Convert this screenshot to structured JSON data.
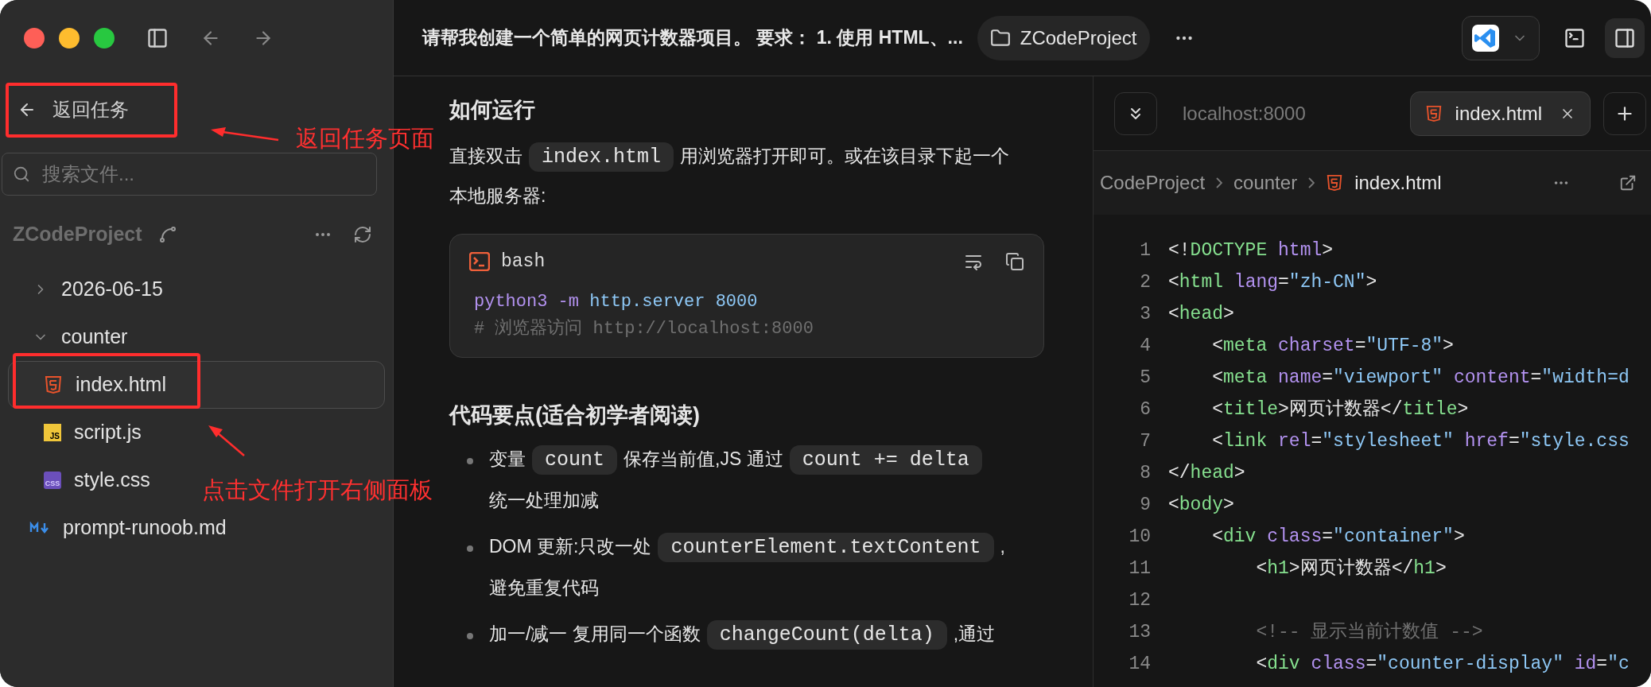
{
  "sidebar": {
    "back_label": "返回任务",
    "search": {
      "placeholder": "搜索文件..."
    },
    "project": "ZCodeProject",
    "tree": [
      {
        "name": "2026-06-15",
        "kind": "folder",
        "expanded": false,
        "selected": false
      },
      {
        "name": "counter",
        "kind": "folder",
        "expanded": true,
        "selected": false,
        "children": [
          {
            "name": "index.html",
            "kind": "html",
            "selected": true
          },
          {
            "name": "script.js",
            "kind": "js",
            "badge": "JS",
            "selected": false
          },
          {
            "name": "style.css",
            "kind": "css",
            "badge": "CSS",
            "selected": false
          }
        ]
      },
      {
        "name": "prompt-runoob.md",
        "kind": "md",
        "selected": false
      }
    ]
  },
  "header": {
    "title": "请帮我创建一个简单的网页计数器项目。 要求： 1. 使用 HTML、...",
    "folder": "ZCodeProject"
  },
  "chat": {
    "heading1": "如何运行",
    "paragraph": [
      {
        "kind": "text",
        "text": "直接双击"
      },
      {
        "kind": "code",
        "text": "index.html"
      },
      {
        "kind": "text",
        "text": "用浏览器打开即可。或在该目录下起一个本地服务器:"
      }
    ],
    "code_block": {
      "language": "bash",
      "lines": [
        [
          {
            "kind": "cmd",
            "text": "python3"
          },
          {
            "kind": "cmd",
            "text": " -m"
          },
          {
            "kind": "arg",
            "text": " http.server"
          },
          {
            "kind": "arg",
            "text": " 8000"
          }
        ],
        [
          {
            "kind": "comment",
            "text": "# 浏览器访问 http://localhost:8000"
          }
        ]
      ]
    },
    "heading2": "代码要点(适合初学者阅读)",
    "bullets": [
      [
        {
          "kind": "text",
          "text": "变量"
        },
        {
          "kind": "code",
          "text": "count"
        },
        {
          "kind": "text",
          "text": "保存当前值,JS 通过"
        },
        {
          "kind": "code",
          "text": "count += delta"
        },
        {
          "kind": "text",
          "text": "统一处理加减"
        }
      ],
      [
        {
          "kind": "text",
          "text": "DOM 更新:只改一处"
        },
        {
          "kind": "code",
          "text": "counterElement.textContent"
        },
        {
          "kind": "text",
          "text": ",避免重复代码"
        }
      ],
      [
        {
          "kind": "text",
          "text": "加一/减一 复用同一个函数"
        },
        {
          "kind": "code",
          "text": "changeCount(delta)"
        },
        {
          "kind": "text",
          "text": ",通过"
        }
      ]
    ]
  },
  "preview": {
    "tabs": [
      {
        "label": "localhost:8000",
        "kind": "web",
        "selected": false
      },
      {
        "label": "index.html",
        "kind": "html",
        "selected": true
      }
    ],
    "breadcrumb": [
      "CodeProject",
      "counter",
      "index.html"
    ],
    "lines": [
      {
        "number": "1",
        "tokens": [
          {
            "kind": "p",
            "text": "<!"
          },
          {
            "kind": "tag",
            "text": "DOCTYPE"
          },
          {
            "kind": "attr",
            "text": " html"
          },
          {
            "kind": "p",
            "text": ">"
          }
        ]
      },
      {
        "number": "2",
        "tokens": [
          {
            "kind": "p",
            "text": "<"
          },
          {
            "kind": "tag",
            "text": "html"
          },
          {
            "kind": "attr",
            "text": " lang"
          },
          {
            "kind": "p",
            "text": "="
          },
          {
            "kind": "str",
            "text": "\"zh-CN\""
          },
          {
            "kind": "p",
            "text": ">"
          }
        ]
      },
      {
        "number": "3",
        "tokens": [
          {
            "kind": "p",
            "text": "<"
          },
          {
            "kind": "tag",
            "text": "head"
          },
          {
            "kind": "p",
            "text": ">"
          }
        ]
      },
      {
        "number": "4",
        "tokens": [
          {
            "kind": "p",
            "text": "    <"
          },
          {
            "kind": "tag",
            "text": "meta"
          },
          {
            "kind": "attr",
            "text": " charset"
          },
          {
            "kind": "p",
            "text": "="
          },
          {
            "kind": "str",
            "text": "\"UTF-8\""
          },
          {
            "kind": "p",
            "text": ">"
          }
        ]
      },
      {
        "number": "5",
        "tokens": [
          {
            "kind": "p",
            "text": "    <"
          },
          {
            "kind": "tag",
            "text": "meta"
          },
          {
            "kind": "attr",
            "text": " name"
          },
          {
            "kind": "p",
            "text": "="
          },
          {
            "kind": "str",
            "text": "\"viewport\""
          },
          {
            "kind": "attr",
            "text": " content"
          },
          {
            "kind": "p",
            "text": "="
          },
          {
            "kind": "str",
            "text": "\"width=d"
          }
        ]
      },
      {
        "number": "6",
        "tokens": [
          {
            "kind": "p",
            "text": "    <"
          },
          {
            "kind": "tag",
            "text": "title"
          },
          {
            "kind": "p",
            "text": ">"
          },
          {
            "kind": "text",
            "text": "网页计数器"
          },
          {
            "kind": "p",
            "text": "</"
          },
          {
            "kind": "tag",
            "text": "title"
          },
          {
            "kind": "p",
            "text": ">"
          }
        ]
      },
      {
        "number": "7",
        "tokens": [
          {
            "kind": "p",
            "text": "    <"
          },
          {
            "kind": "tag",
            "text": "link"
          },
          {
            "kind": "attr",
            "text": " rel"
          },
          {
            "kind": "p",
            "text": "="
          },
          {
            "kind": "str",
            "text": "\"stylesheet\""
          },
          {
            "kind": "attr",
            "text": " href"
          },
          {
            "kind": "p",
            "text": "="
          },
          {
            "kind": "str",
            "text": "\"style.css"
          }
        ]
      },
      {
        "number": "8",
        "tokens": [
          {
            "kind": "p",
            "text": "</"
          },
          {
            "kind": "tag",
            "text": "head"
          },
          {
            "kind": "p",
            "text": ">"
          }
        ]
      },
      {
        "number": "9",
        "tokens": [
          {
            "kind": "p",
            "text": "<"
          },
          {
            "kind": "tag",
            "text": "body"
          },
          {
            "kind": "p",
            "text": ">"
          }
        ]
      },
      {
        "number": "10",
        "tokens": [
          {
            "kind": "p",
            "text": "    <"
          },
          {
            "kind": "tag",
            "text": "div"
          },
          {
            "kind": "attr",
            "text": " class"
          },
          {
            "kind": "p",
            "text": "="
          },
          {
            "kind": "str",
            "text": "\"container\""
          },
          {
            "kind": "p",
            "text": ">"
          }
        ]
      },
      {
        "number": "11",
        "tokens": [
          {
            "kind": "p",
            "text": "        <"
          },
          {
            "kind": "tag",
            "text": "h1"
          },
          {
            "kind": "p",
            "text": ">"
          },
          {
            "kind": "text",
            "text": "网页计数器"
          },
          {
            "kind": "p",
            "text": "</"
          },
          {
            "kind": "tag",
            "text": "h1"
          },
          {
            "kind": "p",
            "text": ">"
          }
        ]
      },
      {
        "number": "12"
      },
      {
        "number": "13",
        "tokens": [
          {
            "kind": "comment",
            "text": "        <!-- 显示当前计数值 -->"
          }
        ]
      },
      {
        "number": "14",
        "tokens": [
          {
            "kind": "p",
            "text": "        <"
          },
          {
            "kind": "tag",
            "text": "div"
          },
          {
            "kind": "attr",
            "text": " class"
          },
          {
            "kind": "p",
            "text": "="
          },
          {
            "kind": "str",
            "text": "\"counter-display\""
          },
          {
            "kind": "attr",
            "text": " id"
          },
          {
            "kind": "p",
            "text": "="
          },
          {
            "kind": "str",
            "text": "\"c"
          }
        ]
      }
    ]
  },
  "annotations": [
    "返回任务页面",
    "点击文件打开右侧面板"
  ]
}
